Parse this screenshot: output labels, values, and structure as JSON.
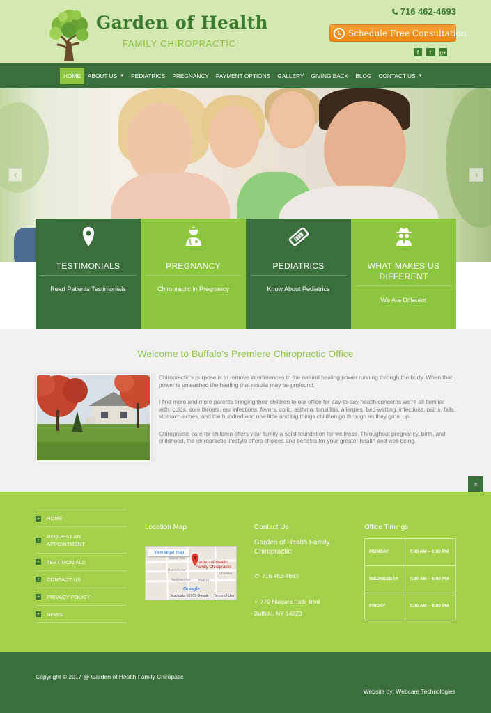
{
  "header": {
    "title": "Garden of Health",
    "subtitle": "FAMILY CHIROPRACTIC",
    "phone": "716 462-4693",
    "cta_label": "Schedule Free Consultation",
    "social_icons": [
      "facebook-icon",
      "twitter-icon",
      "google-plus-icon"
    ],
    "social_glyphs": [
      "f",
      "t",
      "g+"
    ]
  },
  "nav": {
    "items": [
      {
        "label": "HOME",
        "active": true
      },
      {
        "label": "ABOUT US",
        "dropdown": true
      },
      {
        "label": "PEDIATRICS"
      },
      {
        "label": "PREGNANCY"
      },
      {
        "label": "PAYMENT OPTIONS"
      },
      {
        "label": "GALLERY"
      },
      {
        "label": "GIVING BACK"
      },
      {
        "label": "BLOG"
      },
      {
        "label": "CONTACT US",
        "dropdown": true
      }
    ],
    "caret": "▼"
  },
  "slider": {
    "prev_glyph": "‹",
    "next_glyph": "›"
  },
  "features": [
    {
      "icon": "map-pin-icon",
      "title": "TESTIMONIALS",
      "link": "Read Patients Testimonials"
    },
    {
      "icon": "doctor-icon",
      "title": "PREGNANCY",
      "link": "Chiropractic in Pregnancy"
    },
    {
      "icon": "ticket-icon",
      "title": "PEDIATRICS",
      "link": "Know About Pediatrics"
    },
    {
      "icon": "spy-icon",
      "title": "WHAT MAKES US DIFFERENT",
      "link": "We Are Different"
    }
  ],
  "welcome": {
    "title": "Welcome to Buffalo’s Premiere Chiropractic Office",
    "paragraphs": [
      "Chiropractic’s purpose is to remove interferences to the natural healing power running through the body. When that power is unleashed the healing that results may be profound.",
      "I find more and more parents bringing their children to our office for day-to-day health concerns we’re all familiar with: colds, sore throats, ear infections, fevers, colic, asthma, tonsillitis, allergies, bed-wetting, infections, pains, falls, stomach-aches, and the hundred and one little and big things children go through as they grow up.",
      "Chiropractic care for children offers your family a solid foundation for wellness. Throughout pregnancy, birth, and childhood, the chiropractic lifestyle offers choices and benefits for your greater health and well-being."
    ]
  },
  "back_to_top_glyph": "»",
  "footer": {
    "links": [
      "HOME",
      "REQUEST AN APPOINTMENT",
      "TESTIMONIALS",
      "CONTACT US",
      "PRIVACY POLICY",
      "NEWS"
    ],
    "link_glyph": "+",
    "location_heading": "Location Map",
    "map": {
      "view_larger": "View larger map",
      "pin_label": "Garden of Health Family Chiropractic",
      "streets": [
        "Minnie Ave",
        "Harrison Ave",
        "Highland Ave",
        "Park Dr",
        "Charlotte"
      ],
      "google": "Google",
      "map_data": "Map data ©2019 Google",
      "terms": "Terms of Use"
    },
    "contact_heading": "Contact Us",
    "contact_name": "Garden of Health Family Chiropractic",
    "phone": "716 462-4693",
    "address1": "770 Niagara Falls Blvd",
    "address2": "Buffalo, NY 14223",
    "timings_heading": "Office Timings",
    "timings": [
      {
        "day": "MONDAY",
        "hours": "7:00 AM – 6:00 PM"
      },
      {
        "day": "WEDNESDAY",
        "hours": "7:00 AM – 6:00 PM"
      },
      {
        "day": "FRIDAY",
        "hours": "7:00 AM – 6:00 PM"
      }
    ]
  },
  "bottom": {
    "copyright": "Copyright © 2017 @ Garden of Health Family Chiropatic",
    "credit": "Website by: Webcare Technologies"
  },
  "colors": {
    "dark_green": "#3a6f3b",
    "light_green": "#8cc63f",
    "footer_green": "#a3d14c",
    "header_bg": "#d3e9b1",
    "cta_orange": "#f39424"
  }
}
